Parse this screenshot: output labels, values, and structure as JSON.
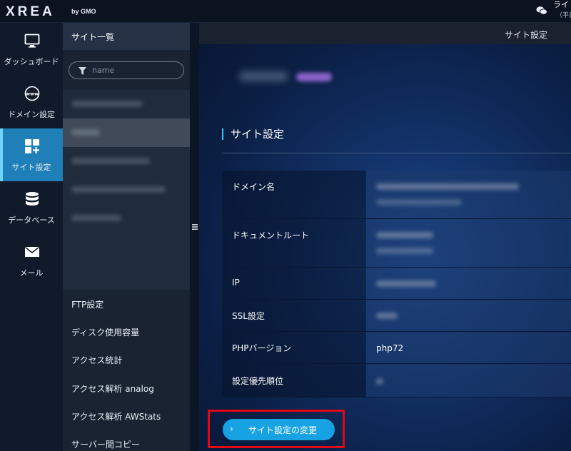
{
  "header": {
    "logo": "XREA",
    "logo_by": "by GMO",
    "user_label": "ライ",
    "user_sub": "（平日",
    "chat_icon": "chat-bubble-icon"
  },
  "leftnav": {
    "items": [
      {
        "label": "ダッシュボード",
        "icon": "monitor-icon"
      },
      {
        "label": "ドメイン設定",
        "icon": "www-globe-icon"
      },
      {
        "label": "サイト設定",
        "icon": "grid-plus-icon",
        "active": true
      },
      {
        "label": "データベース",
        "icon": "database-icon"
      },
      {
        "label": "メール",
        "icon": "envelope-icon"
      }
    ]
  },
  "sidebar": {
    "title": "サイト一覧",
    "search_placeholder": "name",
    "menu": [
      "FTP設定",
      "ディスク使用容量",
      "アクセス統計",
      "アクセス解析 analog",
      "アクセス解析 AWStats",
      "サーバー間コピー"
    ]
  },
  "main": {
    "breadcrumb": "サイト設定",
    "section_title": "サイト設定",
    "rows": [
      {
        "key": "ドメイン名",
        "value": ""
      },
      {
        "key": "ドキュメントルート",
        "value": ""
      },
      {
        "key": "IP",
        "value": ""
      },
      {
        "key": "SSL設定",
        "value": ""
      },
      {
        "key": "PHPバージョン",
        "value": "php72"
      },
      {
        "key": "設定優先順位",
        "value": ""
      }
    ],
    "action_button": "サイト設定の変更",
    "action_chevron": "›"
  },
  "colors": {
    "accent": "#17a3e3",
    "active_nav": "#1f7fb8",
    "highlight": "#e30613"
  }
}
